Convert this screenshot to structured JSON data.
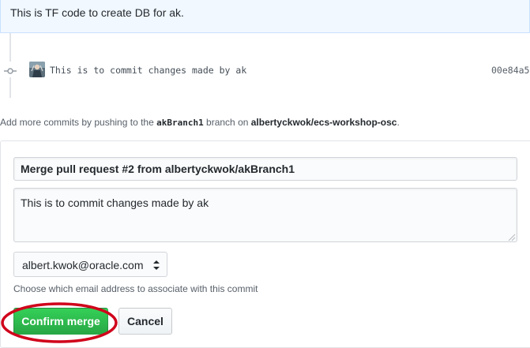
{
  "comment": {
    "text": "This is TF code to create DB for ak."
  },
  "commit": {
    "icon": "git-commit-icon",
    "avatar": "user-avatar",
    "message": "This is to commit changes made by ak",
    "sha": "00e84a5"
  },
  "push_hint": {
    "prefix": "Add more commits by pushing to the ",
    "branch": "akBranch1",
    "middle": " branch on ",
    "repo": "albertyckwok/ecs-workshop-osc",
    "suffix": "."
  },
  "merge": {
    "title_value": "Merge pull request #2 from albertyckwok/akBranch1",
    "body_value": "This is to commit changes made by ak",
    "email_selected": "albert.kwok@oracle.com",
    "email_hint": "Choose which email address to associate with this commit",
    "confirm_label": "Confirm merge",
    "cancel_label": "Cancel"
  },
  "colors": {
    "confirm_green": "#2cbe4e",
    "annotation_red": "#d0021b",
    "comment_bg": "#f1f8ff"
  }
}
